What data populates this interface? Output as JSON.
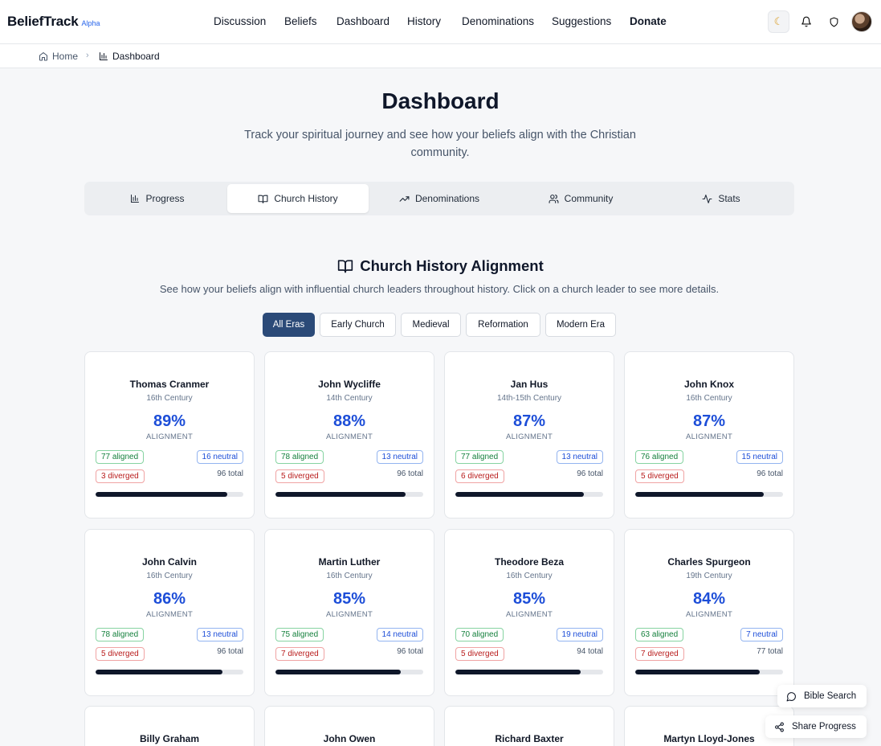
{
  "brand": {
    "name": "BeliefTrack",
    "tag": "Alpha"
  },
  "nav": [
    "Discussion",
    "Beliefs",
    "Dashboard",
    "History",
    "Denominations",
    "Suggestions",
    "Donate"
  ],
  "header_icons": [
    "moon-icon",
    "bell-icon",
    "shield-icon",
    "avatar"
  ],
  "breadcrumb": {
    "home": "Home",
    "current": "Dashboard"
  },
  "page": {
    "title": "Dashboard",
    "subtitle": "Track your spiritual journey and see how your beliefs align with the Christian community."
  },
  "tabs": [
    {
      "label": "Progress",
      "icon": "bar-chart-icon"
    },
    {
      "label": "Church History",
      "icon": "book-open-icon"
    },
    {
      "label": "Denominations",
      "icon": "trending-up-icon"
    },
    {
      "label": "Community",
      "icon": "users-icon"
    },
    {
      "label": "Stats",
      "icon": "activity-icon"
    }
  ],
  "active_tab": "Church History",
  "section": {
    "title": "Church History Alignment",
    "description": "See how your beliefs align with influential church leaders throughout history. Click on a church leader to see more details."
  },
  "eras": [
    "All Eras",
    "Early Church",
    "Medieval",
    "Reformation",
    "Modern Era"
  ],
  "active_era": "All Eras",
  "alignment_label": "ALIGNMENT",
  "leaders": [
    {
      "name": "Thomas Cranmer",
      "era": "16th Century",
      "pct": "89%",
      "aligned": "77 aligned",
      "neutral": "16 neutral",
      "diverged": "3 diverged",
      "total": "96 total",
      "progress": 0.89
    },
    {
      "name": "John Wycliffe",
      "era": "14th Century",
      "pct": "88%",
      "aligned": "78 aligned",
      "neutral": "13 neutral",
      "diverged": "5 diverged",
      "total": "96 total",
      "progress": 0.88
    },
    {
      "name": "Jan Hus",
      "era": "14th-15th Century",
      "pct": "87%",
      "aligned": "77 aligned",
      "neutral": "13 neutral",
      "diverged": "6 diverged",
      "total": "96 total",
      "progress": 0.87
    },
    {
      "name": "John Knox",
      "era": "16th Century",
      "pct": "87%",
      "aligned": "76 aligned",
      "neutral": "15 neutral",
      "diverged": "5 diverged",
      "total": "96 total",
      "progress": 0.87
    },
    {
      "name": "John Calvin",
      "era": "16th Century",
      "pct": "86%",
      "aligned": "78 aligned",
      "neutral": "13 neutral",
      "diverged": "5 diverged",
      "total": "96 total",
      "progress": 0.86
    },
    {
      "name": "Martin Luther",
      "era": "16th Century",
      "pct": "85%",
      "aligned": "75 aligned",
      "neutral": "14 neutral",
      "diverged": "7 diverged",
      "total": "96 total",
      "progress": 0.85
    },
    {
      "name": "Theodore Beza",
      "era": "16th Century",
      "pct": "85%",
      "aligned": "70 aligned",
      "neutral": "19 neutral",
      "diverged": "5 diverged",
      "total": "94 total",
      "progress": 0.85
    },
    {
      "name": "Charles Spurgeon",
      "era": "19th Century",
      "pct": "84%",
      "aligned": "63 aligned",
      "neutral": "7 neutral",
      "diverged": "7 diverged",
      "total": "77 total",
      "progress": 0.84
    },
    {
      "name": "Billy Graham"
    },
    {
      "name": "John Owen"
    },
    {
      "name": "Richard Baxter"
    },
    {
      "name": "Martyn Lloyd-Jones"
    }
  ],
  "floating": {
    "bible_search": "Bible Search",
    "share_progress": "Share Progress"
  }
}
